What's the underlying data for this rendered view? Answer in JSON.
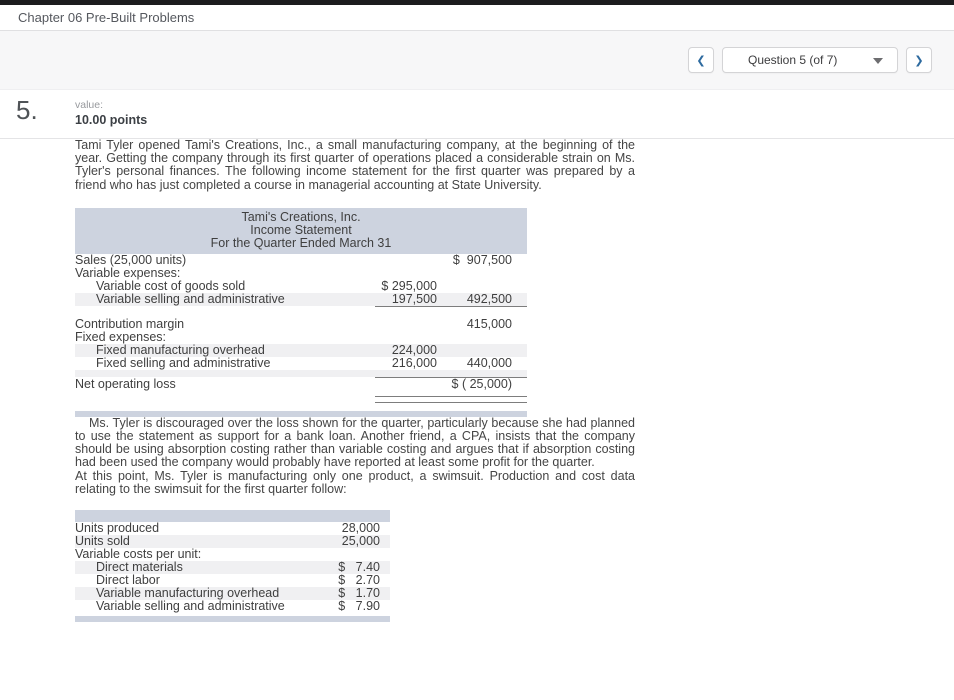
{
  "topbar": {
    "title": "Chapter 06 Pre-Built Problems"
  },
  "nav": {
    "dropdown_value": "Question 5 (of 7)",
    "icons": {
      "chevron_left": "❮",
      "chevron_right": "❯",
      "caret_down": "chevron-down"
    }
  },
  "question": {
    "number": "5.",
    "value_label": "value:",
    "points": "10.00 points"
  },
  "paragraphs": {
    "p1": "Tami Tyler opened Tami's Creations, Inc., a small manufacturing company, at the beginning of the year. Getting the company through its first quarter of operations placed a considerable strain on Ms. Tyler's personal finances. The following income statement for the first quarter was prepared by a friend who has just completed a course in managerial accounting at State University.",
    "p2": "Ms. Tyler is discouraged over the loss shown for the quarter, particularly because she had planned to use the statement as support for a bank loan. Another friend, a CPA, insists that the company should be using absorption costing rather than variable costing and argues that if absorption costing had been used the company would probably have reported at least some profit for the quarter.",
    "p3": "At this point, Ms. Tyler is manufacturing only one product, a swimsuit. Production and cost data relating to the swimsuit for the first quarter follow:"
  },
  "tables": {
    "income": {
      "header": [
        "Tami's Creations, Inc.",
        "Income Statement",
        "For the Quarter Ended March 31"
      ],
      "rows": [
        {
          "label": "Sales (25,000 units)",
          "right": "$  907,500"
        },
        {
          "label": "Variable expenses:"
        },
        {
          "label": "Variable cost of goods sold",
          "indent": 1,
          "mid": "$ 295,000"
        },
        {
          "label": "Variable selling and administrative",
          "indent": 1,
          "mid": "197,500",
          "right": "492,500",
          "shade": 1,
          "line": 1
        },
        {
          "spacer": 12
        },
        {
          "label": "Contribution margin",
          "right": "415,000"
        },
        {
          "label": "Fixed expenses:"
        },
        {
          "label": "Fixed manufacturing overhead",
          "indent": 1,
          "mid": "224,000",
          "shade": 1
        },
        {
          "label": "Fixed selling and administrative",
          "indent": 1,
          "mid": "216,000",
          "right": "440,000"
        },
        {
          "spacer": 7,
          "shade": 1,
          "line": 1
        },
        {
          "label": "Net operating loss",
          "right": "$ ( 25,000)"
        },
        {
          "spacer": 6
        },
        {
          "spacer": 6,
          "dline": 1
        },
        {
          "spacer": 8
        }
      ]
    },
    "production": {
      "rows": [
        {
          "label": "Units produced",
          "val": "28,000"
        },
        {
          "label": "Units sold",
          "val": "25,000",
          "shade": 1
        },
        {
          "label": "Variable costs per unit:"
        },
        {
          "label": "Direct materials",
          "indent": 1,
          "val": "$   7.40",
          "shade": 1
        },
        {
          "label": "Direct labor",
          "indent": 1,
          "val": "$   2.70"
        },
        {
          "label": "Variable manufacturing overhead",
          "indent": 1,
          "val": "$   1.70",
          "shade": 1
        },
        {
          "label": "Variable selling and administrative",
          "indent": 1,
          "val": "$   7.90"
        }
      ]
    }
  },
  "theme": {
    "band": "#cdd3df",
    "stripe": "#f0f0f2",
    "rule": "#7d7d7d",
    "accent_blue": "#2d6a9f"
  }
}
